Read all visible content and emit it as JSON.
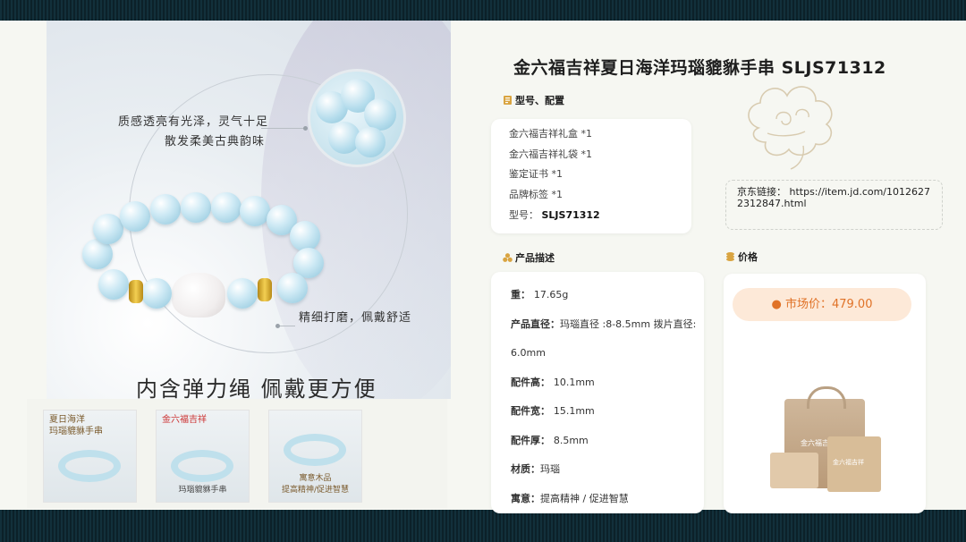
{
  "product": {
    "title": "金六福吉祥夏日海洋玛瑙貔貅手串 SLJS71312"
  },
  "photo": {
    "callout_top_line1": "质感透亮有光泽，灵气十足",
    "callout_top_line2": "散发柔美古典韵味",
    "callout_bottom": "精细打磨，佩戴舒适",
    "caption": "内含弹力绳 佩戴更方便"
  },
  "thumbnails": [
    {
      "top_text": "夏日海洋\n玛瑙貔貅手串",
      "bottom_text": ""
    },
    {
      "top_text": "金六福吉祥",
      "bottom_text": "玛瑙貔貅手串"
    },
    {
      "top_text": "",
      "bottom_text": "寓意木品\n提高精神/促进智慧"
    }
  ],
  "config": {
    "heading": "型号、配置",
    "items": [
      "金六福吉祥礼盒 *1",
      "金六福吉祥礼袋 *1",
      "鉴定证书 *1",
      "品牌标签 *1"
    ],
    "model_label": "型号：",
    "model_value": "SLJS71312"
  },
  "link": {
    "label": "京东链接：",
    "url": "https://item.jd.com/10126272312847.html"
  },
  "description": {
    "heading": "产品描述",
    "rows": [
      {
        "label": "重：",
        "value": "17.65g"
      },
      {
        "label": "产品直径：",
        "value": "玛瑙直径 :8-8.5mm 拨片直径:"
      },
      {
        "label": "",
        "value": "6.0mm"
      },
      {
        "label": "配件高：",
        "value": "10.1mm"
      },
      {
        "label": "配件宽：",
        "value": "15.1mm"
      },
      {
        "label": "配件厚：",
        "value": "8.5mm"
      },
      {
        "label": "材质：",
        "value": "玛瑙"
      },
      {
        "label": "寓意：",
        "value": "提高精神 / 促进智慧"
      }
    ]
  },
  "price": {
    "heading": "价格",
    "label": "● 市场价：479.00",
    "bag_logo": "金六福吉祥",
    "box_logo": "金六福吉祥"
  },
  "colors": {
    "accent_orange": "#e07227",
    "background": "#f6f7f2"
  }
}
